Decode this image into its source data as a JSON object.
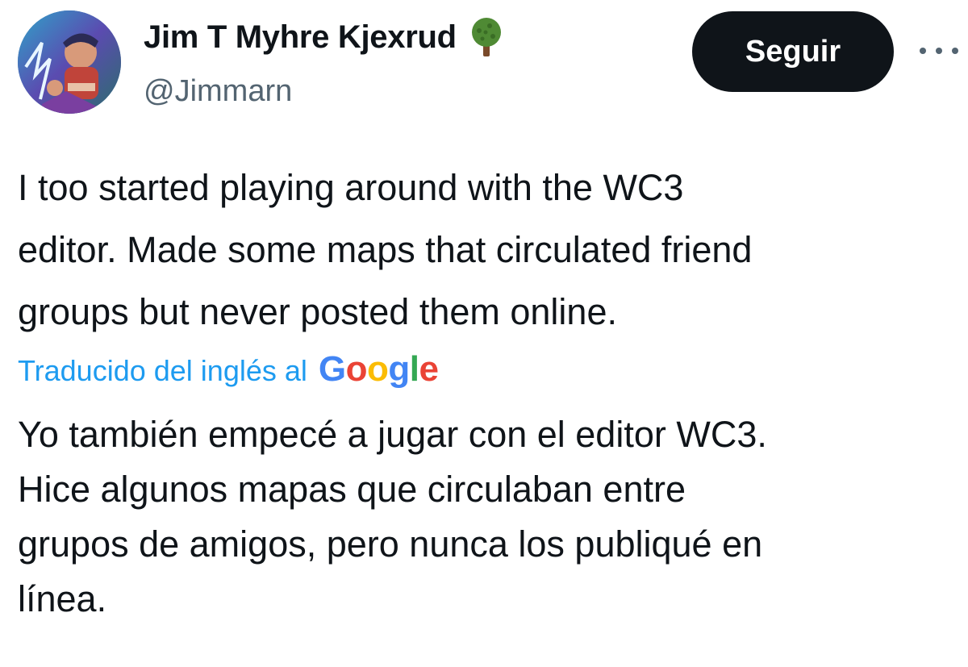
{
  "author": {
    "display_name": "Jim T Myhre Kjexrud",
    "handle": "@Jimmarn",
    "badge_icon": "tree-icon",
    "avatar_icon": "avatar"
  },
  "actions": {
    "follow_label": "Seguir",
    "more_icon": "more-icon"
  },
  "tweet": {
    "lines": [
      "I too started playing around with the WC3",
      "editor. Made some maps that circulated friend",
      "groups but never posted them online."
    ]
  },
  "translation": {
    "label": "Traducido del inglés al",
    "provider": "Google",
    "provider_letters": [
      "G",
      "o",
      "o",
      "g",
      "l",
      "e"
    ],
    "lines": [
      "Yo también empecé a jugar con el editor WC3.",
      "Hice algunos mapas que circulaban entre",
      "grupos de amigos, pero nunca los publiqué en",
      "línea."
    ]
  },
  "colors": {
    "text": "#0f1419",
    "secondary": "#536471",
    "link": "#1d9bf0",
    "button_bg": "#0f1419",
    "google_blue": "#4285F4",
    "google_red": "#EA4335",
    "google_yellow": "#FBBC05",
    "google_green": "#34A853"
  }
}
